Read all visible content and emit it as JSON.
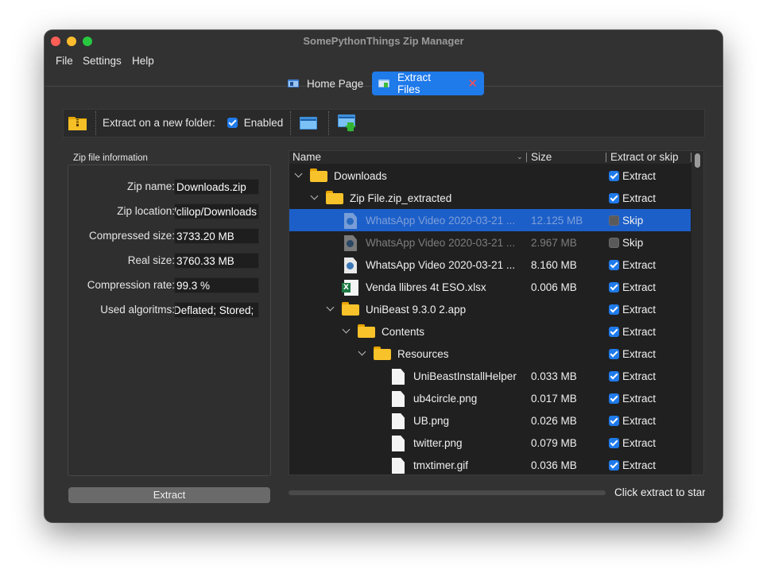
{
  "window": {
    "title": "SomePythonThings Zip Manager"
  },
  "menu": [
    "File",
    "Settings",
    "Help"
  ],
  "tabs": [
    {
      "label": "Home Page",
      "icon": "home-tab-icon",
      "active": false
    },
    {
      "label": "Extract Files",
      "icon": "extract-tab-icon",
      "active": true,
      "closable": true
    }
  ],
  "toolbar": {
    "extract_new_folder_label": "Extract on a new folder:",
    "enabled_label": "Enabled",
    "enabled_checked": true
  },
  "info": {
    "title": "Zip file information",
    "rows": [
      {
        "label": "Zip name:",
        "value": "Downloads.zip"
      },
      {
        "label": "Zip location:",
        "value": "/Users/clilop/Downloads"
      },
      {
        "label": "Compressed size:",
        "value": "3733.20 MB"
      },
      {
        "label": "Real size:",
        "value": "3760.33 MB"
      },
      {
        "label": "Compression rate:",
        "value": "99.3 %"
      },
      {
        "label": "Used algoritms:",
        "value": "Deflated; Stored;"
      }
    ]
  },
  "extract_button": "Extract",
  "tree": {
    "columns": [
      "Name",
      "Size",
      "Extract or skip"
    ],
    "rows": [
      {
        "name": "Downloads",
        "size": "",
        "action": "Extract",
        "checked": true,
        "type": "folder",
        "depth": 0,
        "expanded": true
      },
      {
        "name": "Zip File.zip_extracted",
        "size": "",
        "action": "Extract",
        "checked": true,
        "type": "folder",
        "depth": 1,
        "expanded": true
      },
      {
        "name": "WhatsApp Video 2020-03-21 ...",
        "size": "12.125 MB",
        "action": "Skip",
        "checked": false,
        "type": "video",
        "depth": 2,
        "selected": true,
        "dim": true
      },
      {
        "name": "WhatsApp Video 2020-03-21 ...",
        "size": "2.967 MB",
        "action": "Skip",
        "checked": false,
        "type": "video",
        "depth": 2,
        "dim": true
      },
      {
        "name": "WhatsApp Video 2020-03-21 ...",
        "size": "8.160 MB",
        "action": "Extract",
        "checked": true,
        "type": "video",
        "depth": 2
      },
      {
        "name": "Venda llibres 4t ESO.xlsx",
        "size": "0.006 MB",
        "action": "Extract",
        "checked": true,
        "type": "xls",
        "depth": 2
      },
      {
        "name": "UniBeast 9.3.0 2.app",
        "size": "",
        "action": "Extract",
        "checked": true,
        "type": "folder",
        "depth": 2,
        "expanded": true
      },
      {
        "name": "Contents",
        "size": "",
        "action": "Extract",
        "checked": true,
        "type": "folder",
        "depth": 3,
        "expanded": true
      },
      {
        "name": "Resources",
        "size": "",
        "action": "Extract",
        "checked": true,
        "type": "folder",
        "depth": 4,
        "expanded": true
      },
      {
        "name": "UniBeastInstallHelper",
        "size": "0.033 MB",
        "action": "Extract",
        "checked": true,
        "type": "file",
        "depth": 5
      },
      {
        "name": "ub4circle.png",
        "size": "0.017 MB",
        "action": "Extract",
        "checked": true,
        "type": "file",
        "depth": 5
      },
      {
        "name": "UB.png",
        "size": "0.026 MB",
        "action": "Extract",
        "checked": true,
        "type": "file",
        "depth": 5
      },
      {
        "name": "twitter.png",
        "size": "0.079 MB",
        "action": "Extract",
        "checked": true,
        "type": "file",
        "depth": 5
      },
      {
        "name": "tmxtimer.gif",
        "size": "0.036 MB",
        "action": "Extract",
        "checked": true,
        "type": "file",
        "depth": 5
      }
    ]
  },
  "status": "Click extract to start"
}
